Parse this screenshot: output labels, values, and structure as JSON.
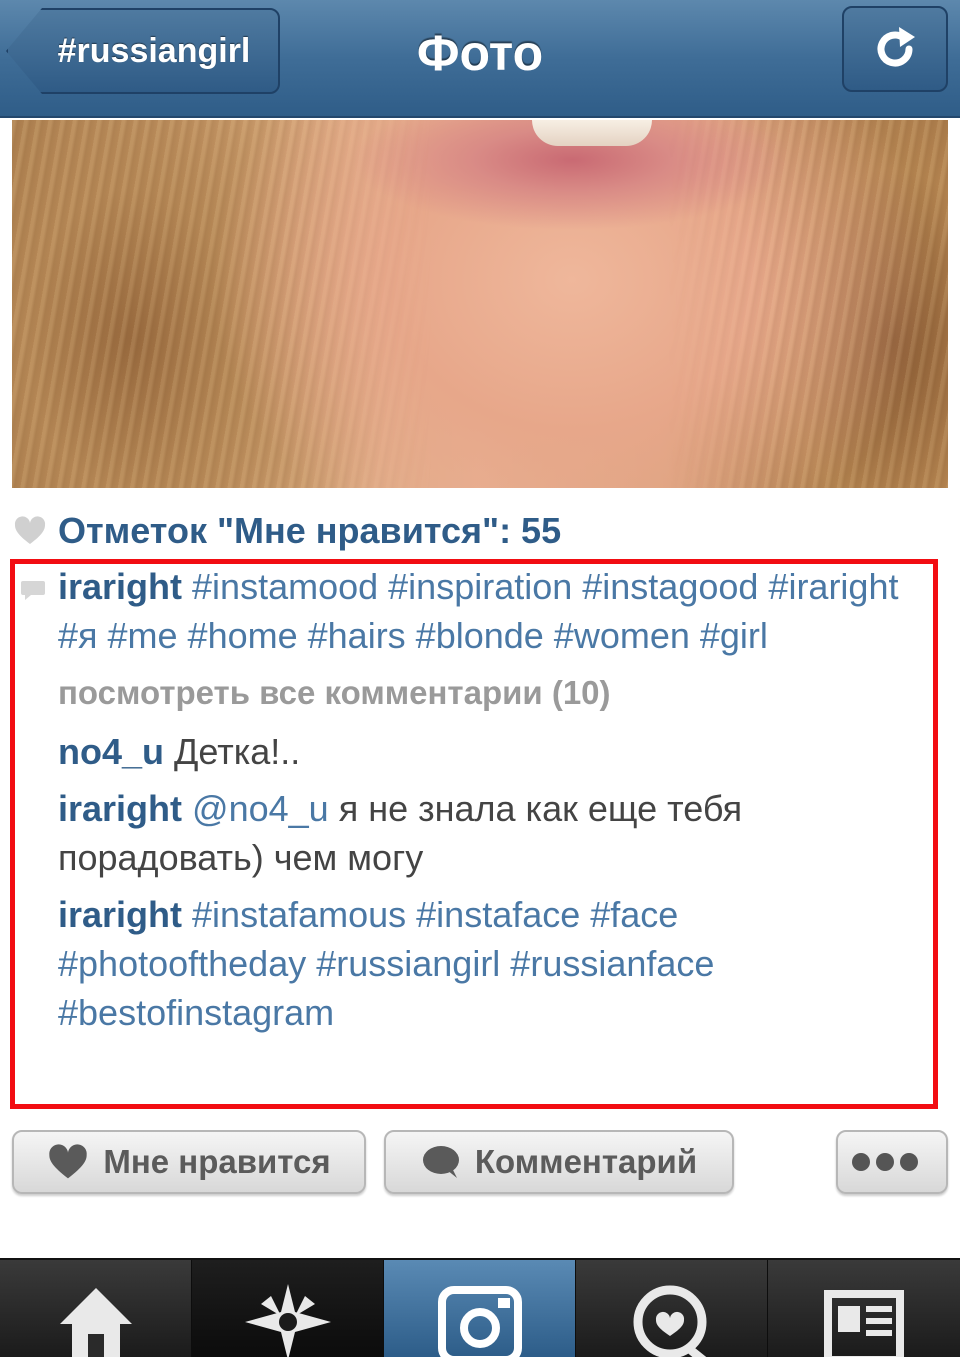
{
  "navbar": {
    "back_label": "#russiangirl",
    "title": "Фото",
    "refresh_icon": "refresh-icon"
  },
  "photo": {
    "description_icon": "photo"
  },
  "likes": {
    "text": "Отметок \"Мне нравится\": 55"
  },
  "caption": {
    "user": "iraright",
    "text": "#instamood #inspiration #instagood #iraright #я #me #home #hairs #blonde #women #girl"
  },
  "view_all": "посмотреть все комментарии (10)",
  "comments": [
    {
      "user": "no4_u",
      "mention": "",
      "text": "Детка!.."
    },
    {
      "user": "iraright",
      "mention": "@no4_u",
      "text": "я не знала как еще тебя порадовать) чем могу"
    },
    {
      "user": "iraright",
      "mention": "",
      "text": "#instafamous #instaface #face #photooftheday #russiangirl #russianface #bestofinstagram"
    }
  ],
  "actions": {
    "like_label": "Мне нравится",
    "comment_label": "Комментарий",
    "more_icon": "more-dots-icon"
  },
  "tabbar": {
    "tabs": [
      {
        "icon": "home-icon",
        "active": false
      },
      {
        "icon": "explore-star-icon",
        "active": false
      },
      {
        "icon": "camera-icon",
        "active": true
      },
      {
        "icon": "news-heart-icon",
        "active": false
      },
      {
        "icon": "profile-icon",
        "active": false
      }
    ]
  },
  "colors": {
    "navbar_blue": "#3f6d97",
    "link_blue": "#2f5c88",
    "highlight_red": "#f20d12"
  }
}
